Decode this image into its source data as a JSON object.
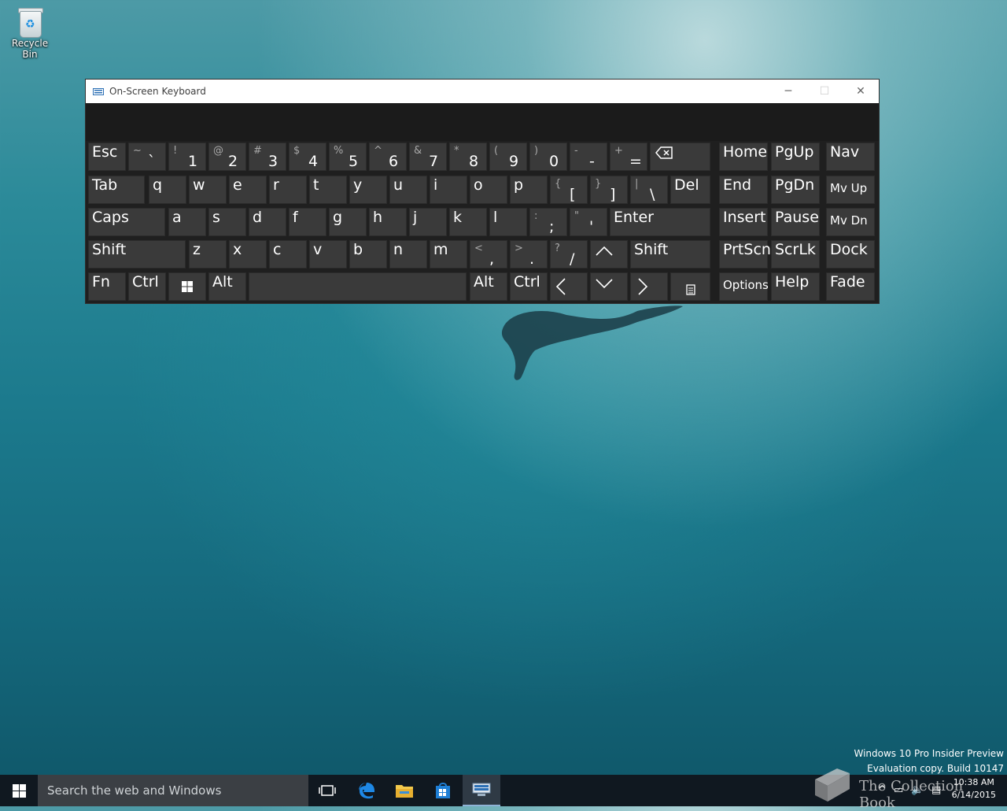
{
  "desktop": {
    "recycle_bin_label": "Recycle Bin",
    "watermark_line1": "Windows 10 Pro Insider Preview",
    "watermark_line2": "Evaluation copy. Build 10147",
    "collection_text": "The Collection Book"
  },
  "window": {
    "title": "On-Screen Keyboard",
    "minimize_icon": "minimize-icon",
    "maximize_icon": "maximize-icon",
    "close_icon": "close-icon"
  },
  "keys": [
    {
      "id": "esc",
      "label": "Esc"
    },
    {
      "id": "grave",
      "top": "~",
      "bot": "`"
    },
    {
      "id": "1",
      "top": "!",
      "bot": "1"
    },
    {
      "id": "2",
      "top": "@",
      "bot": "2"
    },
    {
      "id": "3",
      "top": "#",
      "bot": "3"
    },
    {
      "id": "4",
      "top": "$",
      "bot": "4"
    },
    {
      "id": "5",
      "top": "%",
      "bot": "5"
    },
    {
      "id": "6",
      "top": "^",
      "bot": "6"
    },
    {
      "id": "7",
      "top": "&",
      "bot": "7"
    },
    {
      "id": "8",
      "top": "*",
      "bot": "8"
    },
    {
      "id": "9",
      "top": "(",
      "bot": "9"
    },
    {
      "id": "0",
      "top": ")",
      "bot": "0"
    },
    {
      "id": "minus",
      "top": "-",
      "bot": "-"
    },
    {
      "id": "equals",
      "top": "+",
      "bot": "="
    },
    {
      "id": "backspace",
      "icon": "backspace-icon"
    },
    {
      "id": "home",
      "label": "Home"
    },
    {
      "id": "pgup",
      "label": "PgUp"
    },
    {
      "id": "nav",
      "label": "Nav"
    },
    {
      "id": "tab",
      "label": "Tab"
    },
    {
      "id": "q",
      "label": "q"
    },
    {
      "id": "w",
      "label": "w"
    },
    {
      "id": "e",
      "label": "e"
    },
    {
      "id": "r",
      "label": "r"
    },
    {
      "id": "t",
      "label": "t"
    },
    {
      "id": "y",
      "label": "y"
    },
    {
      "id": "u",
      "label": "u"
    },
    {
      "id": "i",
      "label": "i"
    },
    {
      "id": "o",
      "label": "o"
    },
    {
      "id": "p",
      "label": "p"
    },
    {
      "id": "lbracket",
      "top": "{",
      "bot": "["
    },
    {
      "id": "rbracket",
      "top": "}",
      "bot": "]"
    },
    {
      "id": "backslash",
      "top": "|",
      "bot": "\\"
    },
    {
      "id": "del",
      "label": "Del"
    },
    {
      "id": "end",
      "label": "End"
    },
    {
      "id": "pgdn",
      "label": "PgDn"
    },
    {
      "id": "mvup",
      "label": "Mv Up"
    },
    {
      "id": "caps",
      "label": "Caps"
    },
    {
      "id": "a",
      "label": "a"
    },
    {
      "id": "s",
      "label": "s"
    },
    {
      "id": "d",
      "label": "d"
    },
    {
      "id": "f",
      "label": "f"
    },
    {
      "id": "g",
      "label": "g"
    },
    {
      "id": "h",
      "label": "h"
    },
    {
      "id": "j",
      "label": "j"
    },
    {
      "id": "k",
      "label": "k"
    },
    {
      "id": "l",
      "label": "l"
    },
    {
      "id": "semicolon",
      "top": ":",
      "bot": ";"
    },
    {
      "id": "quote",
      "top": "\"",
      "bot": "'"
    },
    {
      "id": "enter",
      "label": "Enter"
    },
    {
      "id": "insert",
      "label": "Insert"
    },
    {
      "id": "pause",
      "label": "Pause"
    },
    {
      "id": "mvdn",
      "label": "Mv Dn"
    },
    {
      "id": "lshift",
      "label": "Shift"
    },
    {
      "id": "z",
      "label": "z"
    },
    {
      "id": "x",
      "label": "x"
    },
    {
      "id": "c",
      "label": "c"
    },
    {
      "id": "v",
      "label": "v"
    },
    {
      "id": "b",
      "label": "b"
    },
    {
      "id": "n",
      "label": "n"
    },
    {
      "id": "m",
      "label": "m"
    },
    {
      "id": "comma",
      "top": "<",
      "bot": ","
    },
    {
      "id": "period",
      "top": ">",
      "bot": "."
    },
    {
      "id": "slash",
      "top": "?",
      "bot": "/"
    },
    {
      "id": "up",
      "icon": "arrow-up-icon"
    },
    {
      "id": "rshift",
      "label": "Shift"
    },
    {
      "id": "prtscn",
      "label": "PrtScn"
    },
    {
      "id": "scrlk",
      "label": "ScrLk"
    },
    {
      "id": "dock",
      "label": "Dock"
    },
    {
      "id": "fn",
      "label": "Fn"
    },
    {
      "id": "lctrl",
      "label": "Ctrl"
    },
    {
      "id": "win",
      "icon": "windows-logo-icon"
    },
    {
      "id": "lalt",
      "label": "Alt"
    },
    {
      "id": "space",
      "label": ""
    },
    {
      "id": "ralt",
      "label": "Alt"
    },
    {
      "id": "rctrl",
      "label": "Ctrl"
    },
    {
      "id": "left",
      "icon": "arrow-left-icon"
    },
    {
      "id": "down",
      "icon": "arrow-down-icon"
    },
    {
      "id": "right",
      "icon": "arrow-right-icon"
    },
    {
      "id": "menu",
      "icon": "context-menu-icon"
    },
    {
      "id": "options",
      "label": "Options"
    },
    {
      "id": "help",
      "label": "Help"
    },
    {
      "id": "fade",
      "label": "Fade"
    }
  ],
  "taskbar": {
    "search_placeholder": "Search the web and Windows",
    "time": "10:38 AM",
    "date": "6/14/2015",
    "icons": [
      "windows-start-icon",
      "task-view-icon",
      "edge-icon",
      "file-explorer-icon",
      "store-icon",
      "on-screen-keyboard-icon"
    ]
  }
}
